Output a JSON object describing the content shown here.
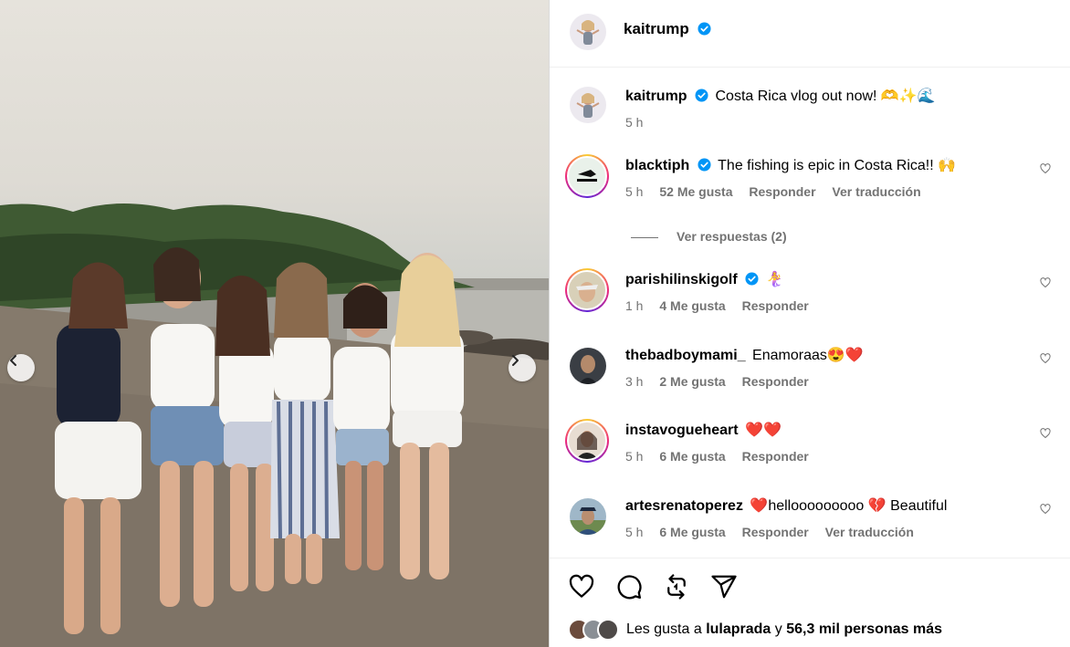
{
  "post": {
    "author": "kaitrump",
    "author_verified": true
  },
  "caption": {
    "username": "kaitrump",
    "text": "Costa Rica vlog out now! 🫶✨🌊",
    "time": "5 h"
  },
  "comments": [
    {
      "username": "blacktiph",
      "verified": true,
      "text": "The fishing is epic in Costa Rica!! 🙌",
      "time": "5 h",
      "likes": "52 Me gusta",
      "reply": "Responder",
      "translate": "Ver traducción"
    },
    {
      "username": "parishilinskigolf",
      "verified": true,
      "text": "🧜‍♀️",
      "time": "1 h",
      "likes": "4 Me gusta",
      "reply": "Responder"
    },
    {
      "username": "thebadboymami_",
      "verified": false,
      "text": "Enamoraas😍❤️",
      "time": "3 h",
      "likes": "2 Me gusta",
      "reply": "Responder"
    },
    {
      "username": "instavogueheart",
      "verified": false,
      "text": "❤️❤️",
      "time": "5 h",
      "likes": "6 Me gusta",
      "reply": "Responder"
    },
    {
      "username": "artesrenatoperez",
      "verified": false,
      "text": "❤️hellooooooooo 💔 Beautiful",
      "time": "5 h",
      "likes": "6 Me gusta",
      "reply": "Responder",
      "translate": "Ver traducción"
    }
  ],
  "view_replies": "Ver respuestas (2)",
  "actions": {
    "like": "heart-icon",
    "comment": "comment-icon",
    "repost": "repost-icon",
    "share": "share-icon"
  },
  "likes_line": {
    "prefix": "Les gusta a",
    "user": "lulaprada",
    "conj": "y",
    "others": "56,3 mil personas más"
  },
  "colors": {
    "verified_blue": "#0095f6",
    "muted": "#737373",
    "heart_red": "#ff3040"
  }
}
